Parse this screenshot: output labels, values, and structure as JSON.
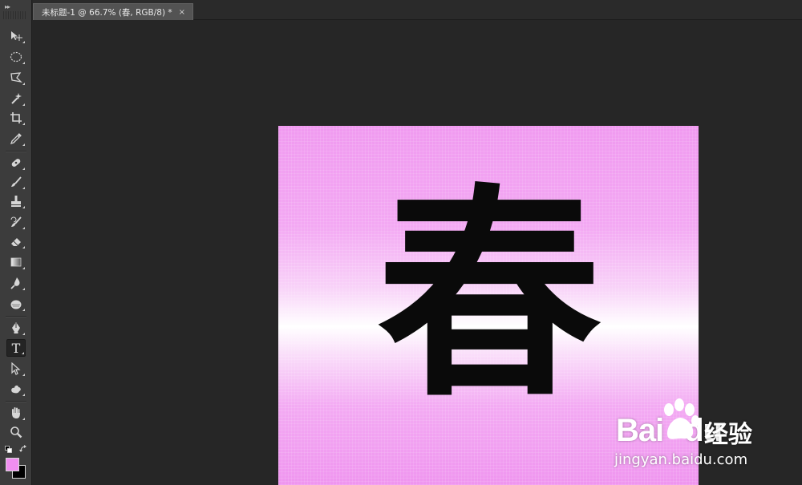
{
  "document_tab": {
    "title": "未标题-1 @ 66.7% (春, RGB/8) *",
    "close_glyph": "×"
  },
  "toolbar": {
    "collapse_glyph": "▸▸",
    "tools": [
      {
        "name": "move-tool",
        "icon": "move-icon"
      },
      {
        "name": "elliptical-marquee-tool",
        "icon": "ellipse-marquee-icon"
      },
      {
        "name": "polygonal-lasso-tool",
        "icon": "lasso-icon"
      },
      {
        "name": "magic-wand-tool",
        "icon": "magic-wand-icon"
      },
      {
        "name": "crop-tool",
        "icon": "crop-icon"
      },
      {
        "name": "eyedropper-tool",
        "icon": "eyedropper-icon"
      },
      {
        "name": "spot-healing-tool",
        "icon": "bandage-icon"
      },
      {
        "name": "brush-tool",
        "icon": "brush-icon"
      },
      {
        "name": "clone-stamp-tool",
        "icon": "stamp-icon"
      },
      {
        "name": "history-brush-tool",
        "icon": "history-brush-icon"
      },
      {
        "name": "eraser-tool",
        "icon": "eraser-icon"
      },
      {
        "name": "gradient-tool",
        "icon": "gradient-icon"
      },
      {
        "name": "blur-tool",
        "icon": "blur-drop-icon"
      },
      {
        "name": "dodge-tool",
        "icon": "dodge-icon"
      },
      {
        "name": "pen-tool",
        "icon": "pen-icon"
      },
      {
        "name": "type-tool",
        "icon": "type-icon",
        "label": "T",
        "active": true
      },
      {
        "name": "path-selection-tool",
        "icon": "path-select-icon"
      },
      {
        "name": "custom-shape-tool",
        "icon": "shape-icon"
      },
      {
        "name": "hand-tool",
        "icon": "hand-icon"
      },
      {
        "name": "zoom-tool",
        "icon": "zoom-icon"
      }
    ],
    "foreground_color": "#f08ef0",
    "background_color": "#000000"
  },
  "canvas": {
    "text": "春",
    "gradient_colors": [
      "#f09af0",
      "#ffffff",
      "#ef95ef"
    ],
    "text_color": "#0a0a0a"
  },
  "watermark": {
    "logo_bai": "Bai",
    "logo_du": "du",
    "jingyan": "经验",
    "url": "jingyan.baidu.com"
  }
}
